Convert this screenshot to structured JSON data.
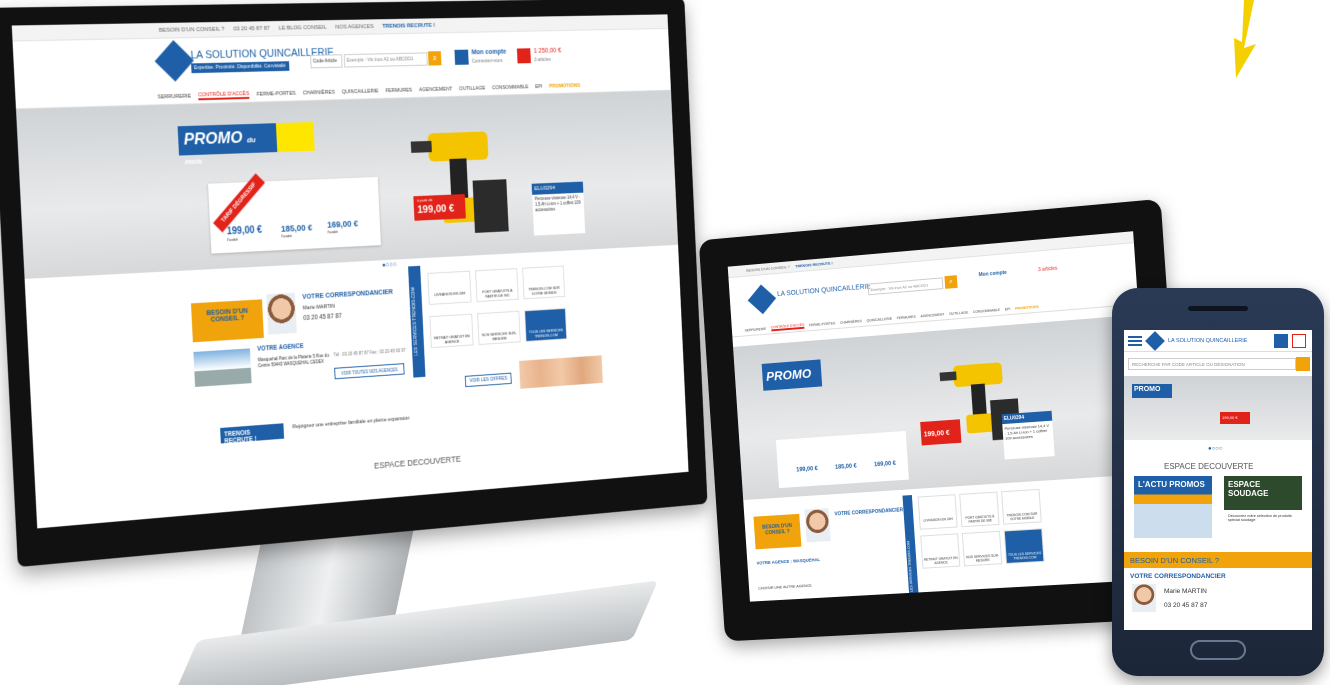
{
  "topbar": {
    "conseil": "BESOIN D'UN CONSEIL ?",
    "phone": "03 20 45 87 87",
    "blog": "LE BLOG CONSEIL",
    "agences": "NOS AGENCES",
    "recrute": "TRENOIS RECRUTE !"
  },
  "header": {
    "logo": "LA SOLUTION QUINCAILLERIE",
    "slogan": "Expertise. Proximité. Disponibilité. Convivialié",
    "search_label": "Code Article",
    "search_placeholder": "Exemple : Vis inox A2 ou ABCDD1",
    "account_title": "Mon compte",
    "account_sub": "Connectez-vous",
    "cart_title": "1 250,00 €",
    "cart_sub": "3 articles"
  },
  "nav": [
    "SERRURERIE",
    "CONTRÔLE D'ACCÈS",
    "FERME-PORTES",
    "CHARNIÈRES",
    "QUINCAILLERIE",
    "FERMURES",
    "AGENCEMENT",
    "OUTILLAGE",
    "CONSOMMABLE",
    "EPI",
    "PROMOTIONS"
  ],
  "hero": {
    "promo": "PROMO",
    "promo_sub": "du mois",
    "tarif": "TARIF DÉGRESSIF",
    "price1": "199,00 €",
    "price2": "185,00 €",
    "price3": "169,00 €",
    "unit": "l'unité",
    "red_tag": "199,00 €",
    "red_tag_pre": "à partir de",
    "model": "ELU0294",
    "model_desc": "Perceuse visseuse 14,4 V - 1,5 Ah Li-ion + 1 coffret 109 accessoires"
  },
  "conseil": {
    "besoin": "BESOIN D'UN CONSEIL ?",
    "corr_title": "VOTRE CORRESPONDANCIER",
    "name": "Marie MARTIN",
    "phone": "03 20 45 87 87",
    "agency_title": "VOTRE AGENCE",
    "agency_addr": "Wasquehal Parc de la Platerie 5 Rue du Centre 59443 WASQUEHAL CEDEX",
    "agency_tel": "Tél : 03 20 45 87 87 Fax : 03 20 45 60 97",
    "agency_btn": "VOIR TOUTES NOS AGENCES"
  },
  "services": {
    "band": "LES SERVICES TRENOIS.COM",
    "items": [
      "LIVRAISON EN 24H",
      "PORT GRATUITS À PARTIR DE 90€",
      "TRENOIS.COM SUR VOTRE MOBILE",
      "RETRAIT GRATUIT EN AGENCE",
      "NOS SERVICES SUR-MESURE",
      "TOUS LES SERVICES TRENOIS.COM"
    ]
  },
  "recrute": {
    "title": "TRENOIS RECRUTE !",
    "text": "Rejoignez une entreprise familiale en pleine expansion",
    "btn": "VOIR LES OFFRES"
  },
  "espace": "ESPACE DECOUVERTE",
  "tablet": {
    "agence": "VOTRE AGENCE : WASQUEHAL",
    "choisir": "CHOISIR UNE AUTRE AGENCE"
  },
  "phone": {
    "logo": "LA SOLUTION QUINCAILLERIE",
    "search": "RECHERCHE PAR CODE ARTICLE OU DÉSIGNATION",
    "espace": "ESPACE DECOUVERTE",
    "img1": "L'ACTU PROMOS",
    "img2": "ESPACE SOUDAGE",
    "img2_sub": "Découvrez notre sélection de produits spécial soudage",
    "conseil": "BESOIN D'UN CONSEIL ?",
    "corr": "VOTRE CORRESPONDANCIER",
    "name": "Marie MARTIN",
    "phone": "03 20 45 87 87"
  },
  "colors": {
    "brand_blue": "#1e5fa8",
    "accent_orange": "#f0a30a",
    "promo_red": "#e2231a"
  }
}
